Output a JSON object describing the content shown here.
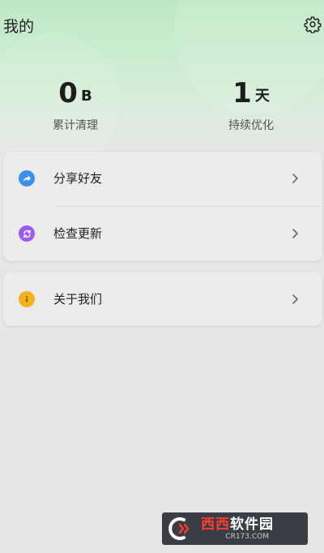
{
  "page": {
    "title": "我的"
  },
  "stats": {
    "cleaned": {
      "value": "0",
      "unit": "B",
      "label": "累计清理"
    },
    "days": {
      "value": "1",
      "unit": "天",
      "label": "持续优化"
    }
  },
  "menu": {
    "share": {
      "label": "分享好友",
      "icon": "share-icon",
      "color": "#3c8ff0"
    },
    "update": {
      "label": "检查更新",
      "icon": "refresh-icon",
      "color": "#9a5cf0"
    },
    "about": {
      "label": "关于我们",
      "icon": "info-icon",
      "color": "#f0b31c"
    }
  },
  "watermark": {
    "brand_red": "西西",
    "brand_white": "软件园",
    "domain": "CR173.COM"
  },
  "colors": {
    "header_green": "#bfe8c6",
    "background": "#e6e6e6"
  }
}
